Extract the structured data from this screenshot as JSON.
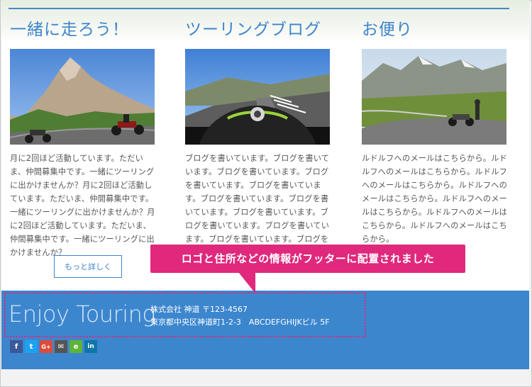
{
  "columns": [
    {
      "title": "一緒に走ろう！",
      "text": "月に2回ほど活動しています。ただいま、仲間募集中です。一緒にツーリングに出かけませんか？月に2回ほど活動しています。ただいま、仲間募集中です。一緒にツーリングに出かけませんか？月に2回ほど活動しています。ただいま、仲間募集中です。一緒にツーリングに出かけませんか？",
      "button": "もっと詳しく"
    },
    {
      "title": "ツーリングブログ",
      "text": "ブログを書いています。ブログを書いています。ブログを書いています。ブログを書いています。ブログを書いています。ブログを書いています。ブログを書いています。ブログを書いています。ブログを書いています。ブログを書いています。ブログを書いています。ブログを書いています。ブログを書いています。",
      "button": ""
    },
    {
      "title": "お便り",
      "text": "ルドルフへのメールはこちらから。ルドルフへのメールはこちらから。ルドルフへのメールはこちらから。ルドルフへのメールはこちらから。ルドルフへのメールはこちらから。ルドルフへのメールはこちらから。ルドルフへのメールはこちらから。",
      "button": ""
    }
  ],
  "callout": "ロゴと住所などの情報がフッターに配置されました",
  "footer": {
    "logo": "Enjoy Touring",
    "company": "株式会社 神道 〒123-4567",
    "address": "東京都中央区神道町1-2-3　ABCDEFGHIJKビル 5F"
  },
  "social": [
    {
      "icon": "facebook-icon",
      "glyph": "f",
      "color": "#3b5998"
    },
    {
      "icon": "twitter-icon",
      "glyph": "t",
      "color": "#1da1f2"
    },
    {
      "icon": "googleplus-icon",
      "glyph": "G+",
      "color": "#dd4b39"
    },
    {
      "icon": "mail-icon",
      "glyph": "✉",
      "color": "#555555"
    },
    {
      "icon": "evernote-icon",
      "glyph": "e",
      "color": "#5fb336"
    },
    {
      "icon": "linkedin-icon",
      "glyph": "in",
      "color": "#0e76a8"
    }
  ],
  "colors": {
    "accent": "#3f85c8",
    "footer": "#3c86ce",
    "callout": "#e0287c"
  }
}
